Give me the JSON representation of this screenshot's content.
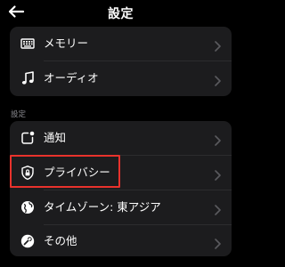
{
  "header": {
    "title": "設定",
    "back_icon": "arrow-left-icon"
  },
  "top_group": {
    "items": [
      {
        "label": "メモリー",
        "icon": "keyboard-icon"
      },
      {
        "label": "オーディオ",
        "icon": "music-note-icon"
      }
    ]
  },
  "settings_group": {
    "section_label": "設定",
    "items": [
      {
        "label": "通知",
        "icon": "notification-icon"
      },
      {
        "label": "プライバシー",
        "icon": "lock-shield-icon"
      },
      {
        "label": "タイムゾーン: 東アジア",
        "icon": "globe-icon"
      },
      {
        "label": "その他",
        "icon": "wrench-icon"
      }
    ]
  },
  "colors": {
    "background": "#000000",
    "card": "#1c1c1e",
    "highlight_border": "#e8322c",
    "chevron": "#5a5a5e",
    "section_label": "#8e8e93"
  }
}
